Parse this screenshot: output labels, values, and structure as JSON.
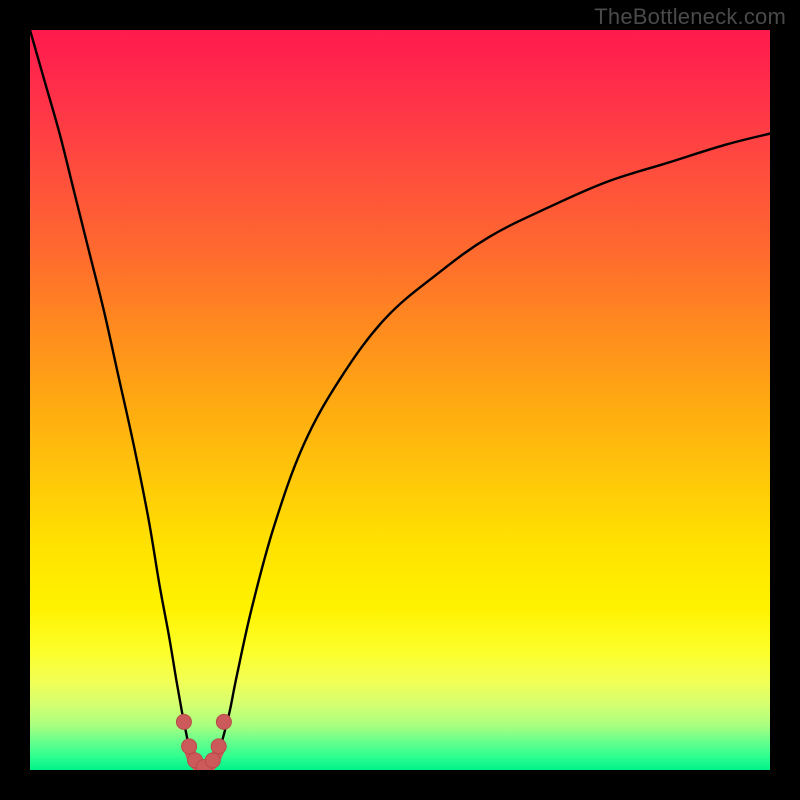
{
  "watermark": "TheBottleneck.com",
  "colors": {
    "frame_background": "#000000",
    "curve_stroke": "#000000",
    "marker_fill": "#cc5a5a",
    "marker_stroke": "#b84a4a"
  },
  "chart_data": {
    "type": "line",
    "title": "",
    "xlabel": "",
    "ylabel": "",
    "xlim": [
      0,
      100
    ],
    "ylim": [
      0,
      100
    ],
    "grid": false,
    "legend": false,
    "series": [
      {
        "name": "left-branch",
        "x": [
          0,
          2,
          4,
          6,
          8,
          10,
          12,
          14,
          16,
          17.5,
          18.8,
          19.8,
          20.6,
          21.2,
          21.6,
          22.0
        ],
        "values": [
          100,
          93,
          86,
          78,
          70,
          62,
          53,
          44,
          34,
          25,
          18,
          12,
          7.5,
          4.5,
          2.5,
          1.5
        ]
      },
      {
        "name": "right-branch",
        "x": [
          25.0,
          25.6,
          26.2,
          27.0,
          28.0,
          30,
          33,
          37,
          42,
          48,
          55,
          62,
          70,
          78,
          86,
          94,
          100
        ],
        "values": [
          1.5,
          2.8,
          4.8,
          8,
          13,
          22,
          33,
          44,
          53,
          61,
          67,
          72,
          76,
          79.5,
          82,
          84.5,
          86
        ]
      },
      {
        "name": "valley-bottom",
        "x": [
          22.0,
          22.5,
          23.0,
          23.5,
          24.0,
          24.5,
          25.0
        ],
        "values": [
          1.5,
          0.7,
          0.3,
          0.2,
          0.3,
          0.7,
          1.5
        ]
      }
    ],
    "markers": {
      "points_x": [
        20.8,
        21.5,
        22.3,
        23.5,
        24.7,
        25.5,
        26.2
      ],
      "points_y": [
        6.5,
        3.2,
        1.3,
        0.4,
        1.3,
        3.2,
        6.5
      ]
    },
    "background_gradient": {
      "orientation": "vertical",
      "stops": [
        {
          "pos": 0.0,
          "color": "#ff1a4d"
        },
        {
          "pos": 0.3,
          "color": "#ff6a2e"
        },
        {
          "pos": 0.6,
          "color": "#ffc60a"
        },
        {
          "pos": 0.84,
          "color": "#fcff2a"
        },
        {
          "pos": 1.0,
          "color": "#00f28a"
        }
      ]
    }
  }
}
